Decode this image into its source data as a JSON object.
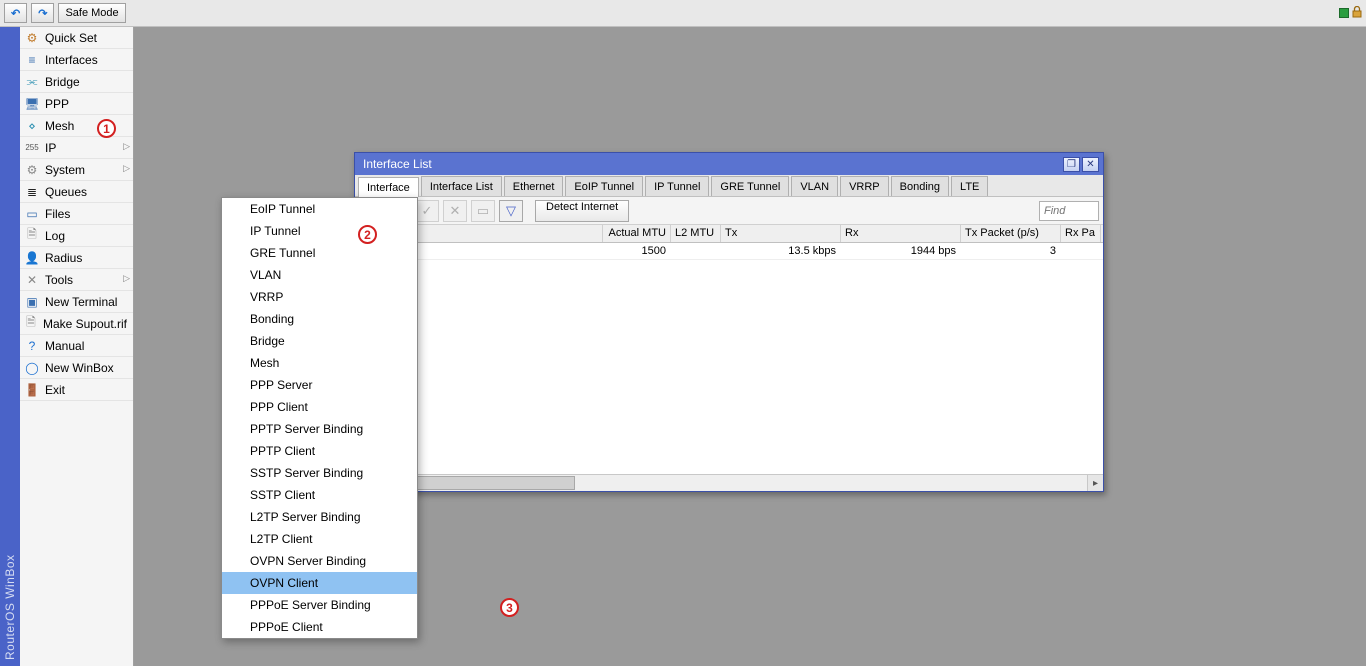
{
  "app_title": "RouterOS WinBox",
  "toolbar": {
    "undo_glyph": "↶",
    "redo_glyph": "↷",
    "safe_mode": "Safe Mode"
  },
  "sidebar": {
    "items": [
      {
        "label": "Quick Set",
        "icon": "⚙",
        "color": "#c07a2a"
      },
      {
        "label": "Interfaces",
        "icon": "≡",
        "color": "#3a6fb0"
      },
      {
        "label": "Bridge",
        "icon": "⫘",
        "color": "#2a8fb0"
      },
      {
        "label": "PPP",
        "icon": "🖥",
        "color": "#3a6fb0"
      },
      {
        "label": "Mesh",
        "icon": "⋄",
        "color": "#2a8fb0"
      },
      {
        "label": "IP",
        "icon": "255",
        "color": "#555",
        "sub": true
      },
      {
        "label": "System",
        "icon": "⚙",
        "color": "#888",
        "sub": true
      },
      {
        "label": "Queues",
        "icon": "≣",
        "color": "#222"
      },
      {
        "label": "Files",
        "icon": "▭",
        "color": "#3a6fb0"
      },
      {
        "label": "Log",
        "icon": "🗎",
        "color": "#888"
      },
      {
        "label": "Radius",
        "icon": "👤",
        "color": "#c07a2a"
      },
      {
        "label": "Tools",
        "icon": "✕",
        "color": "#888",
        "sub": true
      },
      {
        "label": "New Terminal",
        "icon": "▣",
        "color": "#3a6fb0"
      },
      {
        "label": "Make Supout.rif",
        "icon": "🗎",
        "color": "#888"
      },
      {
        "label": "Manual",
        "icon": "?",
        "color": "#1b6fd0"
      },
      {
        "label": "New WinBox",
        "icon": "◯",
        "color": "#1b6fd0"
      },
      {
        "label": "Exit",
        "icon": "🚪",
        "color": "#7a4a2a"
      }
    ]
  },
  "window": {
    "title": "Interface List",
    "tabs": [
      "Interface",
      "Interface List",
      "Ethernet",
      "EoIP Tunnel",
      "IP Tunnel",
      "GRE Tunnel",
      "VLAN",
      "VRRP",
      "Bonding",
      "LTE"
    ],
    "active_tab": 0,
    "toolbar": {
      "add": "✚",
      "remove": "—",
      "enable": "✓",
      "disable": "✕",
      "comment": "▭",
      "filter": "▽",
      "detect": "Detect Internet",
      "find_placeholder": "Find"
    },
    "columns": [
      "",
      "Actual MTU",
      "L2 MTU",
      "Tx",
      "Rx",
      "Tx Packet (p/s)",
      "Rx Pa"
    ],
    "row": {
      "actual_mtu": "1500",
      "l2_mtu": "",
      "tx": "13.5 kbps",
      "rx": "1944 bps",
      "tx_pps": "3"
    }
  },
  "dropdown": {
    "items": [
      "EoIP Tunnel",
      "IP Tunnel",
      "GRE Tunnel",
      "VLAN",
      "VRRP",
      "Bonding",
      "Bridge",
      "Mesh",
      "PPP Server",
      "PPP Client",
      "PPTP Server Binding",
      "PPTP Client",
      "SSTP Server Binding",
      "SSTP Client",
      "L2TP Server Binding",
      "L2TP Client",
      "OVPN Server Binding",
      "OVPN Client",
      "PPPoE Server Binding",
      "PPPoE Client"
    ],
    "selected_index": 17
  },
  "annotations": {
    "a1": "1",
    "a2": "2",
    "a3": "3"
  }
}
